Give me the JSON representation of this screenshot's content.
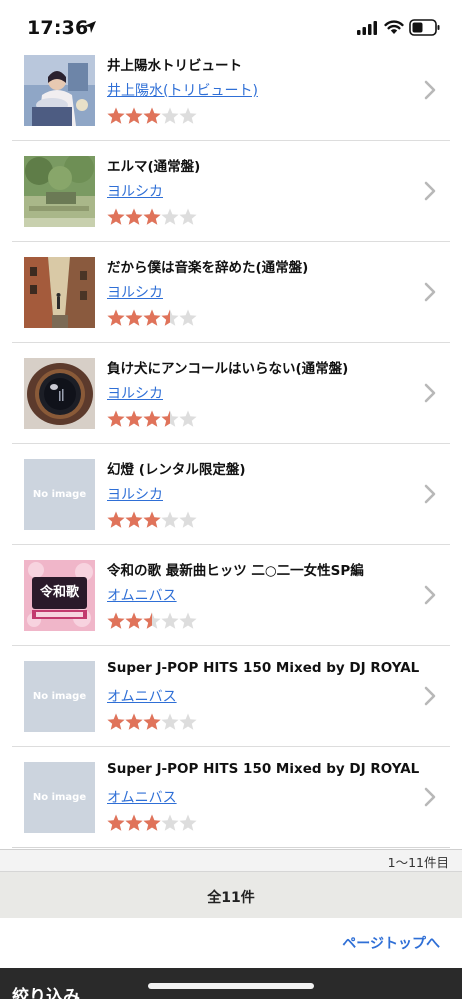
{
  "status": {
    "time": "17:36"
  },
  "items": [
    {
      "title": "井上陽水トリビュート",
      "artist": "井上陽水(トリビュート)",
      "rating": 3,
      "image": "art",
      "art": "tribute"
    },
    {
      "title": "エルマ(通常盤)",
      "artist": "ヨルシカ",
      "rating": 3,
      "image": "art",
      "art": "elma"
    },
    {
      "title": "だから僕は音楽を辞めた(通常盤)",
      "artist": "ヨルシカ",
      "rating": 3.5,
      "image": "art",
      "art": "dakara"
    },
    {
      "title": "負け犬にアンコールはいらない(通常盤)",
      "artist": "ヨルシカ",
      "rating": 3.5,
      "image": "art",
      "art": "makeinu"
    },
    {
      "title": "幻燈 (レンタル限定盤)",
      "artist": "ヨルシカ",
      "rating": 3,
      "image": "noimage",
      "noimage_label": "No image"
    },
    {
      "title": "令和の歌 最新曲ヒッツ 二○二一女性SP編",
      "artist": "オムニバス",
      "rating": 2.5,
      "image": "art",
      "art": "reiwa"
    },
    {
      "title": "Super J-POP HITS 150 Mixed by DJ ROYAL",
      "artist": "オムニバス",
      "rating": 3,
      "image": "noimage",
      "noimage_label": "No image"
    },
    {
      "title": "Super J-POP HITS 150 Mixed by DJ ROYAL",
      "artist": "オムニバス",
      "rating": 3,
      "image": "noimage",
      "noimage_label": "No image"
    }
  ],
  "pagination": {
    "range": "1〜11件目",
    "total": "全11件"
  },
  "page_top": "ページトップへ",
  "filter_label": "絞り込み",
  "colors": {
    "star_filled": "#e0735a",
    "star_empty": "#dddddd",
    "link": "#2f6fd6",
    "chevron": "#b8b8b8"
  }
}
